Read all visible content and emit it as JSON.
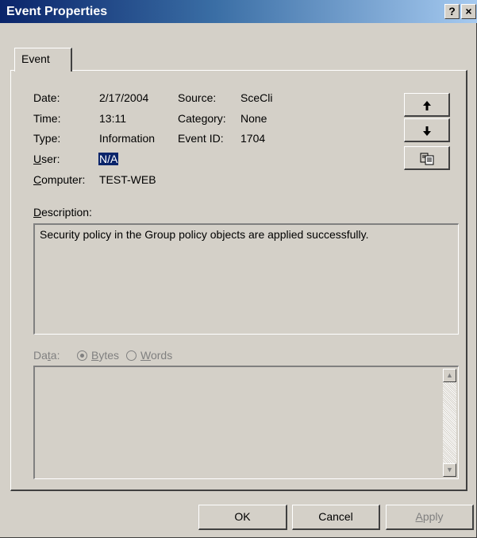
{
  "window": {
    "title": "Event Properties",
    "help_label": "?",
    "close_label": "×"
  },
  "tabs": [
    {
      "label": "Event"
    }
  ],
  "fields": {
    "date_label": "Date:",
    "date_value": "2/17/2004",
    "time_label": "Time:",
    "time_value": "13:11",
    "type_label": "Type:",
    "type_value": "Information",
    "user_label_first": "U",
    "user_label_rest": "ser:",
    "user_value": "N/A",
    "computer_label_first": "C",
    "computer_label_rest": "omputer:",
    "computer_value": "TEST-WEB",
    "source_label": "Source:",
    "source_value": "SceCli",
    "category_label": "Category:",
    "category_value": "None",
    "eventid_label": "Event ID:",
    "eventid_value": "1704"
  },
  "description": {
    "label_first": "D",
    "label_rest": "escription:",
    "text": "Security policy in the Group policy objects are applied successfully."
  },
  "data": {
    "label_pre": "Da",
    "label_u": "t",
    "label_post": "a:",
    "bytes_first": "B",
    "bytes_rest": "ytes",
    "words_first": "W",
    "words_rest": "ords",
    "selected": "Bytes"
  },
  "side_buttons": {
    "up_icon": "arrow-up-icon",
    "down_icon": "arrow-down-icon",
    "copy_icon": "copy-icon"
  },
  "buttons": {
    "ok": "OK",
    "cancel": "Cancel",
    "apply_first": "A",
    "apply_rest": "pply"
  },
  "colors": {
    "title_gradient_start": "#0a246a",
    "title_gradient_end": "#a6caf0",
    "face": "#d4d0c8",
    "selection": "#0a246a"
  }
}
